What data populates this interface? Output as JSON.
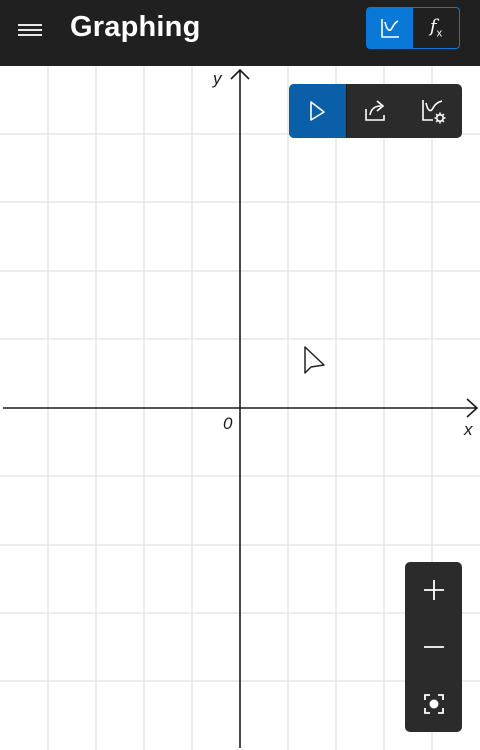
{
  "header": {
    "title": "Graphing",
    "menu_icon": "hamburger-menu-icon",
    "mode_graph_icon": "graph-mode-icon",
    "mode_function_label": "f",
    "mode_function_sub": "x",
    "active_mode": "graph"
  },
  "graph_toolbar": {
    "items": [
      {
        "icon": "select-cursor-icon",
        "active": true
      },
      {
        "icon": "share-icon",
        "active": false
      },
      {
        "icon": "graph-options-icon",
        "active": false
      }
    ]
  },
  "axes": {
    "x_label": "x",
    "y_label": "y",
    "origin_label": "0"
  },
  "zoom_controls": {
    "zoom_in_icon": "plus-icon",
    "zoom_out_icon": "minus-icon",
    "reset_view_icon": "fit-view-icon"
  },
  "colors": {
    "header_bg": "#202020",
    "accent": "#0a78d7",
    "toolbar_bg": "#2b2b2b",
    "grid": "#e0e0e0"
  }
}
